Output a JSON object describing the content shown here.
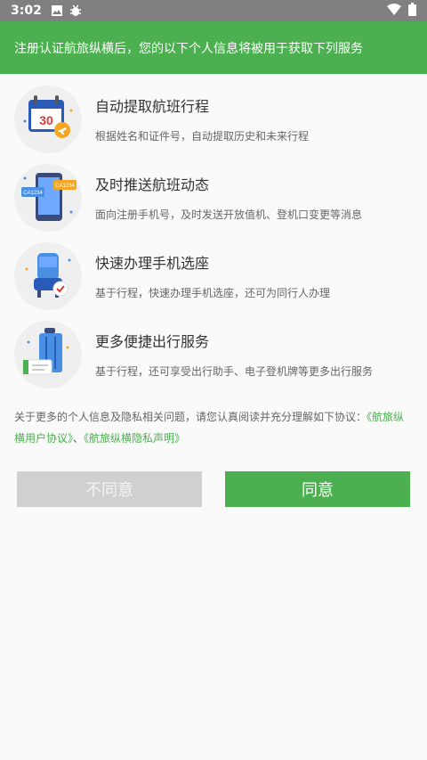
{
  "status_bar": {
    "time": "3:02",
    "icons": [
      "image-icon",
      "bug-icon",
      "wifi-icon",
      "battery-icon"
    ]
  },
  "banner": {
    "text": "注册认证航旅纵横后，您的以下个人信息将被用于获取下列服务"
  },
  "features": [
    {
      "icon": "calendar-plane-icon",
      "title": "自动提取航班行程",
      "desc": "根据姓名和证件号，自动提取历史和未来行程"
    },
    {
      "icon": "phone-flight-ticket-icon",
      "title": "及时推送航班动态",
      "desc": "面向注册手机号，及时发送开放值机、登机口变更等消息"
    },
    {
      "icon": "seat-check-icon",
      "title": "快速办理手机选座",
      "desc": "基于行程，快速办理手机选座，还可为同行人办理"
    },
    {
      "icon": "luggage-ticket-icon",
      "title": "更多便捷出行服务",
      "desc": "基于行程，还可享受出行助手、电子登机牌等更多出行服务"
    }
  ],
  "agreement": {
    "text": "关于更多的个人信息及隐私相关问题，请您认真阅读并充分理解如下协议：",
    "link1": "《航旅纵横用户协议》",
    "separator": "、",
    "link2": "《航旅纵横隐私声明》"
  },
  "buttons": {
    "disagree": "不同意",
    "agree": "同意"
  },
  "icon_texts": {
    "calendar_day": "30",
    "ticket1": "CA1234",
    "ticket2": "CA1234"
  },
  "colors": {
    "brand_green": "#4caf50",
    "status_bar": "#808080",
    "disagree_bg": "#d0d0d0"
  }
}
